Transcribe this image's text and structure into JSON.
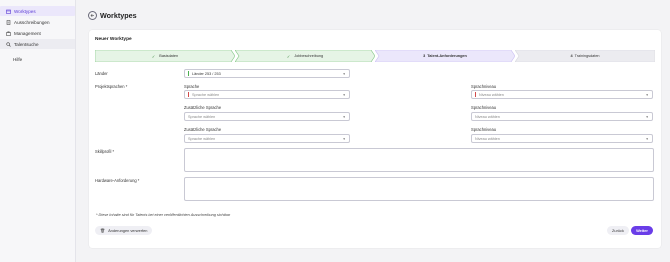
{
  "sidebar": {
    "items": [
      {
        "label": "Worktypes",
        "icon": "worktypes-icon",
        "active": true
      },
      {
        "label": "Ausschreibungen",
        "icon": "document-icon",
        "active": false
      },
      {
        "label": "Management",
        "icon": "briefcase-icon",
        "active": false
      },
      {
        "label": "Talentsuche",
        "icon": "search-icon",
        "active": false
      }
    ],
    "help_label": "Hilfe"
  },
  "header": {
    "title": "Worktypes"
  },
  "form": {
    "title": "Neuer Worktype",
    "steps": [
      {
        "label": "Basisdaten",
        "state": "done",
        "number": ""
      },
      {
        "label": "Jobbeschreibung",
        "state": "done",
        "number": ""
      },
      {
        "label": "Talent-Anforderungen",
        "state": "active",
        "number": "3"
      },
      {
        "label": "Trainingsdaten",
        "state": "pending",
        "number": "4"
      }
    ],
    "countries_label": "Länder",
    "countries_value": "Länder 253 / 253",
    "project_languages_label": "Projektsprachen *",
    "language_label": "Sprache",
    "language_placeholder": "Sprache wählen",
    "additional_language_label": "Zusätzliche Sprache",
    "level_label": "Sprachniveau",
    "level_placeholder": "Niveau wählen",
    "skillprofile_label": "Skillprofil *",
    "hardware_label": "Hardware-Anforderung *",
    "note": "* Diese Inhalte sind für Talents bei einer veröffentlichten Ausschreibung sichtbar",
    "discard_label": "Änderungen verwerfen",
    "back_label": "Zurück",
    "next_label": "Weiter"
  },
  "colors": {
    "accent": "#6a3de8",
    "step_done_bg": "#e6f4e6",
    "step_done_border": "#7cc47f",
    "step_active_bg": "#ebe7fb",
    "step_pending_bg": "#ececf0",
    "required_marker": "#d14b4b",
    "valid_marker": "#4caf50"
  }
}
